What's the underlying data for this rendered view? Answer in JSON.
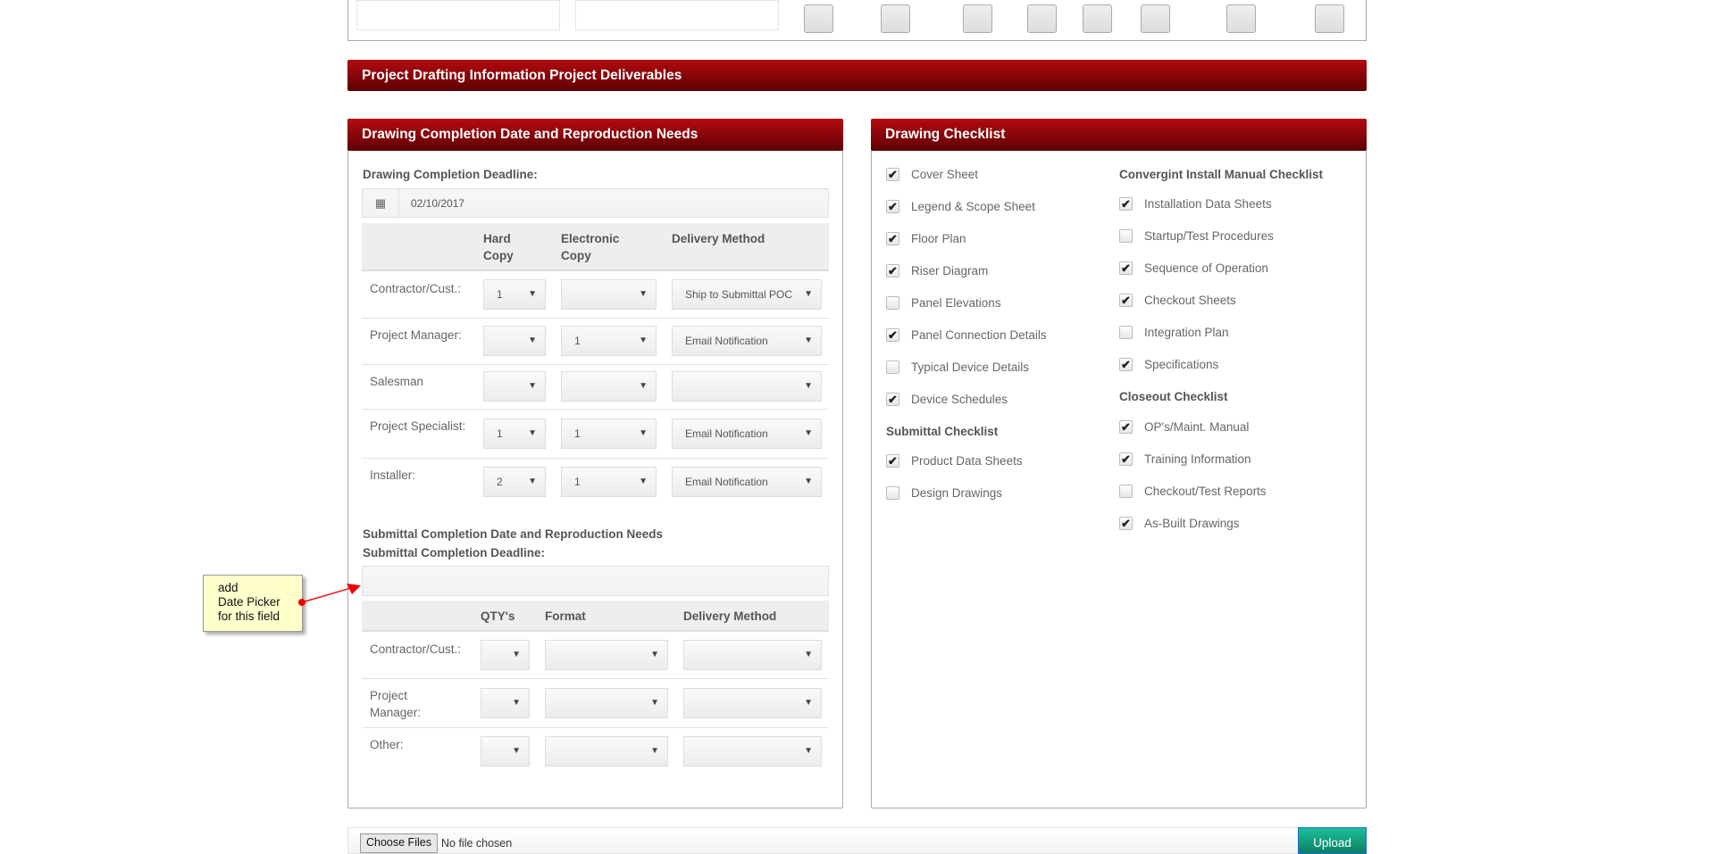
{
  "banner": {
    "title": "Project Drafting Information Project Deliverables"
  },
  "left_panel": {
    "title": "Drawing Completion Date and Reproduction Needs",
    "deadline_label": "Drawing Completion Deadline:",
    "deadline_value": "02/10/2017",
    "headers": [
      "Hard Copy",
      "Electronic Copy",
      "Delivery Method"
    ],
    "rows": [
      {
        "label": "Contractor/Cust.:",
        "hard": "1",
        "electronic": "",
        "delivery": "Ship to Submittal POC"
      },
      {
        "label": "Project Manager:",
        "hard": "",
        "electronic": "1",
        "delivery": "Email Notification"
      },
      {
        "label": "Salesman",
        "hard": "",
        "electronic": "",
        "delivery": ""
      },
      {
        "label": "Project Specialist:",
        "hard": "1",
        "electronic": "1",
        "delivery": "Email Notification"
      },
      {
        "label": "Installer:",
        "hard": "2",
        "electronic": "1",
        "delivery": "Email Notification"
      }
    ],
    "submittal_title": "Submittal Completion Date and Reproduction Needs",
    "submittal_deadline_label": "Submittal Completion Deadline:",
    "submittal_deadline_value": "",
    "submittal_headers": [
      "QTY's",
      "Format",
      "Delivery Method"
    ],
    "submittal_rows": [
      {
        "label": "Contractor/Cust.:",
        "qty": "",
        "format": "",
        "delivery": ""
      },
      {
        "label": "Project Manager:",
        "qty": "",
        "format": "",
        "delivery": ""
      },
      {
        "label": "Other:",
        "qty": "",
        "format": "",
        "delivery": ""
      }
    ]
  },
  "right_panel": {
    "title": "Drawing Checklist",
    "col1": [
      {
        "label": "Cover Sheet",
        "checked": true
      },
      {
        "label": "Legend & Scope Sheet",
        "checked": true
      },
      {
        "label": "Floor Plan",
        "checked": true
      },
      {
        "label": "Riser Diagram",
        "checked": true
      },
      {
        "label": "Panel Elevations",
        "checked": false
      },
      {
        "label": "Panel Connection Details",
        "checked": true
      },
      {
        "label": "Typical Device Details",
        "checked": false
      },
      {
        "label": "Device Schedules",
        "checked": true
      }
    ],
    "submittal_heading": "Submittal Checklist",
    "submittal": [
      {
        "label": "Product Data Sheets",
        "checked": true
      },
      {
        "label": "Design Drawings",
        "checked": false
      }
    ],
    "install_heading": "Convergint Install Manual Checklist",
    "install": [
      {
        "label": "Installation Data Sheets",
        "checked": true
      },
      {
        "label": "Startup/Test Procedures",
        "checked": false
      },
      {
        "label": "Sequence of Operation",
        "checked": true
      },
      {
        "label": "Checkout Sheets",
        "checked": true
      },
      {
        "label": "Integration Plan",
        "checked": false
      },
      {
        "label": "Specifications",
        "checked": true
      }
    ],
    "closeout_heading": "Closeout Checklist",
    "closeout": [
      {
        "label": "OP's/Maint. Manual",
        "checked": true
      },
      {
        "label": "Training Information",
        "checked": true
      },
      {
        "label": "Checkout/Test Reports",
        "checked": false
      },
      {
        "label": "As-Built Drawings",
        "checked": true
      }
    ]
  },
  "annotation": {
    "lines": [
      "add",
      "Date Picker",
      "for this field"
    ]
  },
  "upload": {
    "choose_label": "Choose Files",
    "status": "No file chosen",
    "upload_label": "Upload"
  },
  "colors": {
    "banner": "#a00a0e",
    "upload": "#18a383"
  }
}
